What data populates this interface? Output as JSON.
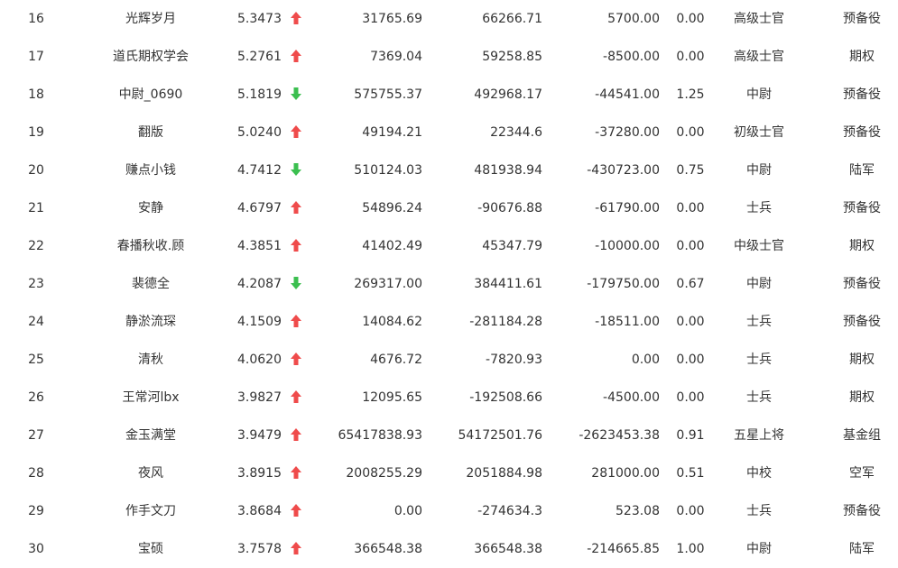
{
  "colors": {
    "up": "#ef4b4b",
    "down": "#3bbf4f",
    "text": "#333333"
  },
  "rows": [
    {
      "rank": "16",
      "name": "光辉岁月",
      "value": "5.3473",
      "trend": "up",
      "a": "31765.69",
      "b": "66266.71",
      "c": "5700.00",
      "ratio": "0.00",
      "title": "高级士官",
      "group": "预备役"
    },
    {
      "rank": "17",
      "name": "道氏期权学会",
      "value": "5.2761",
      "trend": "up",
      "a": "7369.04",
      "b": "59258.85",
      "c": "-8500.00",
      "ratio": "0.00",
      "title": "高级士官",
      "group": "期权"
    },
    {
      "rank": "18",
      "name": "中尉_0690",
      "value": "5.1819",
      "trend": "down",
      "a": "575755.37",
      "b": "492968.17",
      "c": "-44541.00",
      "ratio": "1.25",
      "title": "中尉",
      "group": "预备役"
    },
    {
      "rank": "19",
      "name": "翻版",
      "value": "5.0240",
      "trend": "up",
      "a": "49194.21",
      "b": "22344.6",
      "c": "-37280.00",
      "ratio": "0.00",
      "title": "初级士官",
      "group": "预备役"
    },
    {
      "rank": "20",
      "name": "赚点小钱",
      "value": "4.7412",
      "trend": "down",
      "a": "510124.03",
      "b": "481938.94",
      "c": "-430723.00",
      "ratio": "0.75",
      "title": "中尉",
      "group": "陆军"
    },
    {
      "rank": "21",
      "name": "安静",
      "value": "4.6797",
      "trend": "up",
      "a": "54896.24",
      "b": "-90676.88",
      "c": "-61790.00",
      "ratio": "0.00",
      "title": "士兵",
      "group": "预备役"
    },
    {
      "rank": "22",
      "name": "春播秋收.顾",
      "value": "4.3851",
      "trend": "up",
      "a": "41402.49",
      "b": "45347.79",
      "c": "-10000.00",
      "ratio": "0.00",
      "title": "中级士官",
      "group": "期权"
    },
    {
      "rank": "23",
      "name": "裴德全",
      "value": "4.2087",
      "trend": "down",
      "a": "269317.00",
      "b": "384411.61",
      "c": "-179750.00",
      "ratio": "0.67",
      "title": "中尉",
      "group": "预备役"
    },
    {
      "rank": "24",
      "name": "静淤流琛",
      "value": "4.1509",
      "trend": "up",
      "a": "14084.62",
      "b": "-281184.28",
      "c": "-18511.00",
      "ratio": "0.00",
      "title": "士兵",
      "group": "预备役"
    },
    {
      "rank": "25",
      "name": "清秋",
      "value": "4.0620",
      "trend": "up",
      "a": "4676.72",
      "b": "-7820.93",
      "c": "0.00",
      "ratio": "0.00",
      "title": "士兵",
      "group": "期权"
    },
    {
      "rank": "26",
      "name": "王常河lbx",
      "value": "3.9827",
      "trend": "up",
      "a": "12095.65",
      "b": "-192508.66",
      "c": "-4500.00",
      "ratio": "0.00",
      "title": "士兵",
      "group": "期权"
    },
    {
      "rank": "27",
      "name": "金玉满堂",
      "value": "3.9479",
      "trend": "up",
      "a": "65417838.93",
      "b": "54172501.76",
      "c": "-2623453.38",
      "ratio": "0.91",
      "title": "五星上将",
      "group": "基金组"
    },
    {
      "rank": "28",
      "name": "夜风",
      "value": "3.8915",
      "trend": "up",
      "a": "2008255.29",
      "b": "2051884.98",
      "c": "281000.00",
      "ratio": "0.51",
      "title": "中校",
      "group": "空军"
    },
    {
      "rank": "29",
      "name": "作手文刀",
      "value": "3.8684",
      "trend": "up",
      "a": "0.00",
      "b": "-274634.3",
      "c": "523.08",
      "ratio": "0.00",
      "title": "士兵",
      "group": "预备役"
    },
    {
      "rank": "30",
      "name": "宝硕",
      "value": "3.7578",
      "trend": "up",
      "a": "366548.38",
      "b": "366548.38",
      "c": "-214665.85",
      "ratio": "1.00",
      "title": "中尉",
      "group": "陆军"
    }
  ]
}
